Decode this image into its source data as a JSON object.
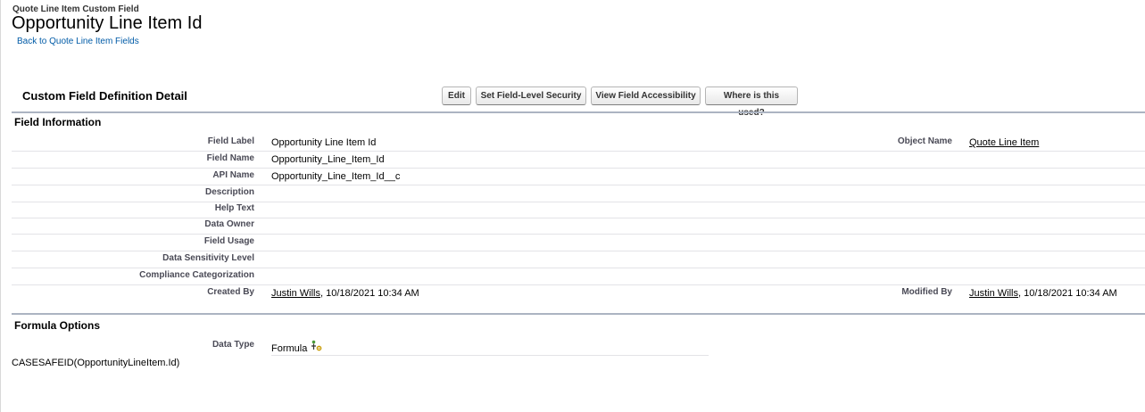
{
  "header": {
    "type_label": "Quote Line Item Custom Field",
    "title": "Opportunity Line Item Id",
    "back_link": "Back to Quote Line Item Fields"
  },
  "detail": {
    "title": "Custom Field Definition Detail",
    "buttons": {
      "edit": "Edit",
      "field_security": "Set Field-Level Security",
      "field_accessibility": "View Field Accessibility",
      "where_used": "Where is this used?"
    }
  },
  "field_info": {
    "title": "Field Information",
    "rows": [
      {
        "label": "Field Label",
        "value": "Opportunity Line Item Id"
      },
      {
        "label": "Field Name",
        "value": "Opportunity_Line_Item_Id"
      },
      {
        "label": "API Name",
        "value": "Opportunity_Line_Item_Id__c"
      },
      {
        "label": "Description",
        "value": ""
      },
      {
        "label": "Help Text",
        "value": ""
      },
      {
        "label": "Data Owner",
        "value": ""
      },
      {
        "label": "Field Usage",
        "value": ""
      },
      {
        "label": "Data Sensitivity Level",
        "value": ""
      },
      {
        "label": "Compliance Categorization",
        "value": ""
      }
    ],
    "object_name": {
      "label": "Object Name",
      "value": "Quote Line Item"
    },
    "created_by": {
      "label": "Created By",
      "user": "Justin Wills",
      "date": ", 10/18/2021 10:34 AM"
    },
    "modified_by": {
      "label": "Modified By",
      "user": "Justin Wills",
      "date": ", 10/18/2021 10:34 AM"
    }
  },
  "formula_options": {
    "title": "Formula Options",
    "data_type_label": "Data Type",
    "data_type_value": "Formula",
    "formula": "CASESAFEID(OpportunityLineItem.Id)"
  },
  "icons": {
    "formula": "formula-icon"
  }
}
